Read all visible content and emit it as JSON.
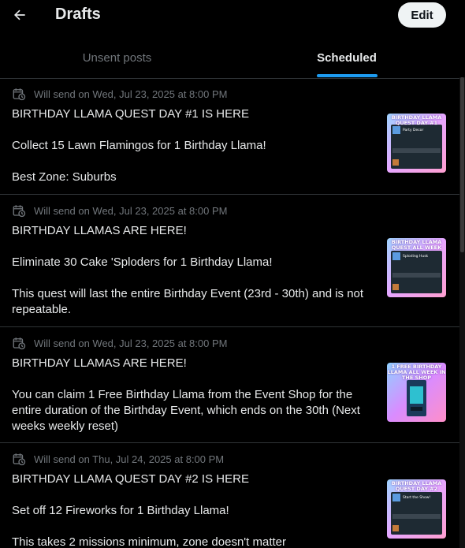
{
  "header": {
    "title": "Drafts",
    "edit_label": "Edit"
  },
  "tabs": [
    {
      "label": "Unsent posts",
      "active": false
    },
    {
      "label": "Scheduled",
      "active": true
    }
  ],
  "drafts": [
    {
      "schedule": "Will send on Wed, Jul 23, 2025 at 8:00 PM",
      "lines": [
        "BIRTHDAY LLAMA QUEST DAY #1 IS HERE",
        "",
        "Collect 15 Lawn Flamingos for 1 Birthday Llama!",
        "",
        "Best Zone: Suburbs"
      ],
      "thumb": {
        "title": "BIRTHDAY LLAMA QUEST DAY #1",
        "card": "Party Decor",
        "desc": "What's a party without some great decorations?",
        "task": "Collect flamingo lawn ornaments",
        "reward": "Birthday Llama Token"
      }
    },
    {
      "schedule": "Will send on Wed, Jul 23, 2025 at 8:00 PM",
      "lines": [
        "BIRTHDAY LLAMAS ARE HERE!",
        "",
        "Eliminate 30 Cake 'Sploders for 1 Birthday Llama!",
        "",
        "This quest will last the entire Birthday Event (23rd - 30th) and is not repeatable."
      ],
      "thumb": {
        "title": "BIRTHDAY LLAMA QUEST ALL WEEK",
        "card": "Sploding Husk",
        "desc": "Put an end to the husk celebrations. Take out those Cake Sploders!",
        "task": "Eliminate cake sploders",
        "reward": "Birthday Llama Token"
      }
    },
    {
      "schedule": "Will send on Wed, Jul 23, 2025 at 8:00 PM",
      "lines": [
        "BIRTHDAY LLAMAS ARE HERE!",
        "",
        "You can claim 1 Free Birthday Llama from the Event Shop for the entire duration of the Birthday Event, which ends on the 30th (Next weeks weekly reset)"
      ],
      "thumb": {
        "title": "1 FREE BIRTHDAY LLAMA ALL WEEK IN THE SHOP"
      }
    },
    {
      "schedule": "Will send on Thu, Jul 24, 2025 at 8:00 PM",
      "lines": [
        "BIRTHDAY LLAMA QUEST DAY #2 IS HERE",
        "",
        "Set off 12 Fireworks for 1 Birthday Llama!",
        "",
        "This takes 2 missions minimum, zone doesn't matter"
      ],
      "thumb": {
        "title": "BIRTHDAY LLAMA QUEST DAY #2",
        "card": "Start the Show!",
        "desc": "Start the celebration and light off these fireworks!",
        "task": "Light off fireworks",
        "reward": "Birthday Llama Token"
      }
    }
  ],
  "colors": {
    "background": "#000000",
    "text": "#e7e9ea",
    "muted": "#71767b",
    "accent": "#1d9bf0",
    "divider": "#2f3336",
    "thumb_purple": "#b23cd8"
  }
}
